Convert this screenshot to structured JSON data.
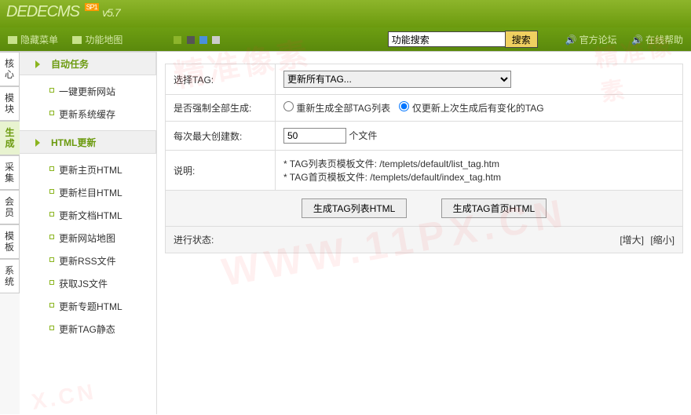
{
  "header": {
    "logo": "DEDECMS",
    "sp": "SP1",
    "version": "v5.7"
  },
  "subheader": {
    "hide_menu": "隐藏菜单",
    "feature_map": "功能地图",
    "search_placeholder": "功能搜索",
    "search_btn": "搜索",
    "forum": "官方论坛",
    "help": "在线帮助"
  },
  "rail": [
    {
      "label": "核心"
    },
    {
      "label": "模块"
    },
    {
      "label": "生成",
      "active": true
    },
    {
      "label": "采集"
    },
    {
      "label": "会员"
    },
    {
      "label": "模板"
    },
    {
      "label": "系统"
    }
  ],
  "sidebar": {
    "group1": {
      "title": "自动任务",
      "items": [
        "一键更新网站",
        "更新系统缓存"
      ]
    },
    "group2": {
      "title": "HTML更新",
      "items": [
        "更新主页HTML",
        "更新栏目HTML",
        "更新文档HTML",
        "更新网站地图",
        "更新RSS文件",
        "获取JS文件",
        "更新专题HTML",
        "更新TAG静态"
      ]
    }
  },
  "form": {
    "select_tag": {
      "label": "选择TAG:",
      "value": "更新所有TAG..."
    },
    "force": {
      "label": "是否强制全部生成:",
      "opt1": "重新生成全部TAG列表",
      "opt2": "仅更新上次生成后有变化的TAG"
    },
    "max": {
      "label": "每次最大创建数:",
      "value": "50",
      "unit": "个文件"
    },
    "desc": {
      "label": "说明:",
      "line1": "* TAG列表页模板文件: /templets/default/list_tag.htm",
      "line2": "* TAG首页模板文件: /templets/default/index_tag.htm"
    },
    "btn1": "生成TAG列表HTML",
    "btn2": "生成TAG首页HTML",
    "progress": {
      "label": "进行状态:",
      "enlarge": "[增大]",
      "shrink": "[缩小]"
    }
  }
}
